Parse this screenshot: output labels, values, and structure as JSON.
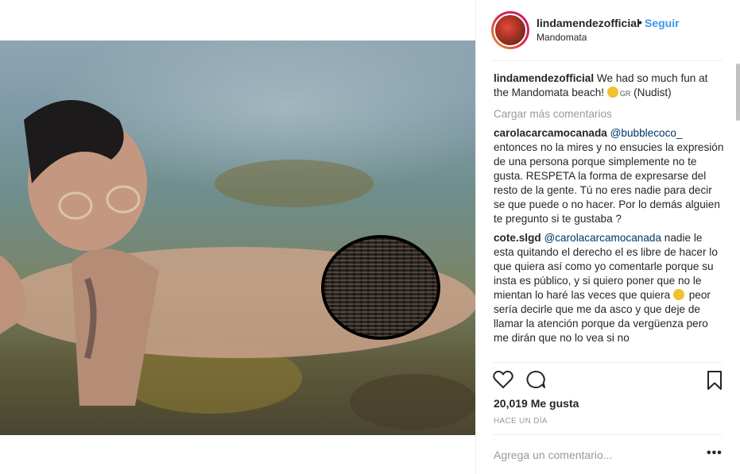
{
  "post": {
    "username": "lindamendezofficial",
    "dot": "•",
    "follow_label": "Seguir",
    "location": "Mandomata"
  },
  "caption": {
    "username": "lindamendezofficial",
    "text": "We had so much fun at the Mandomata beach!",
    "flag": "GR",
    "suffix": "(Nudist)"
  },
  "load_more": "Cargar más comentarios",
  "comments": [
    {
      "username": "carolacarcamocanada",
      "mention": "@bubblecoco_",
      "text": "entonces no la mires y no ensucies la expresión de una persona porque simplemente no te gusta. RESPETA la forma de expresarse del resto de la gente. Tú no eres nadie para decir se que puede o no hacer. Por lo demás alguien te pregunto si te gustaba ?"
    },
    {
      "username": "cote.slgd",
      "mention": "@carolacarcamocanada",
      "text": "nadie le esta quitando el derecho el es libre de hacer lo que quiera así como yo comentarle porque su insta es público, y si quiero poner que no le mientan lo haré las veces que quiera",
      "text2": "peor sería decirle que me da asco y que deje de llamar la atención porque da vergüenza pero me dirán que no lo vea si no"
    }
  ],
  "icons": {
    "heart": "heart-icon",
    "comment": "comment-icon",
    "bookmark": "bookmark-icon",
    "more": "more-options-icon"
  },
  "likes": "20,019 Me gusta",
  "timestamp": "HACE UN DÍA",
  "add_comment": {
    "placeholder": "Agrega un comentario..."
  },
  "more_options": "•••",
  "colors": {
    "link_blue": "#3897f0",
    "mention_blue": "#003569",
    "muted": "#999999",
    "text": "#262626"
  }
}
